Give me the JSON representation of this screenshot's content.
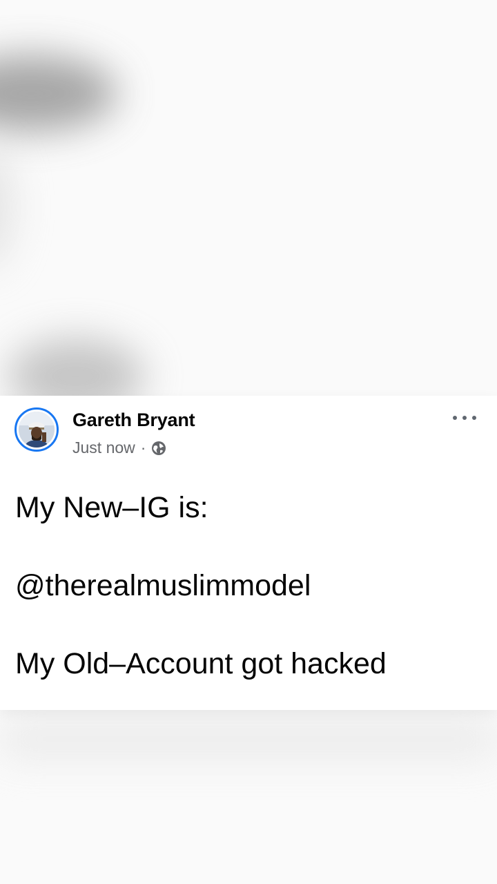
{
  "post": {
    "author_name": "Gareth Bryant",
    "timestamp": "Just now",
    "separator": "·",
    "privacy_icon": "globe-icon",
    "more_icon": "more-horizontal-icon",
    "lines": [
      "My New–IG is:",
      "@therealmuslimmodel",
      "My Old–Account got hacked"
    ]
  },
  "colors": {
    "avatar_ring": "#1877f2",
    "name": "#050505",
    "meta": "#65676b"
  }
}
